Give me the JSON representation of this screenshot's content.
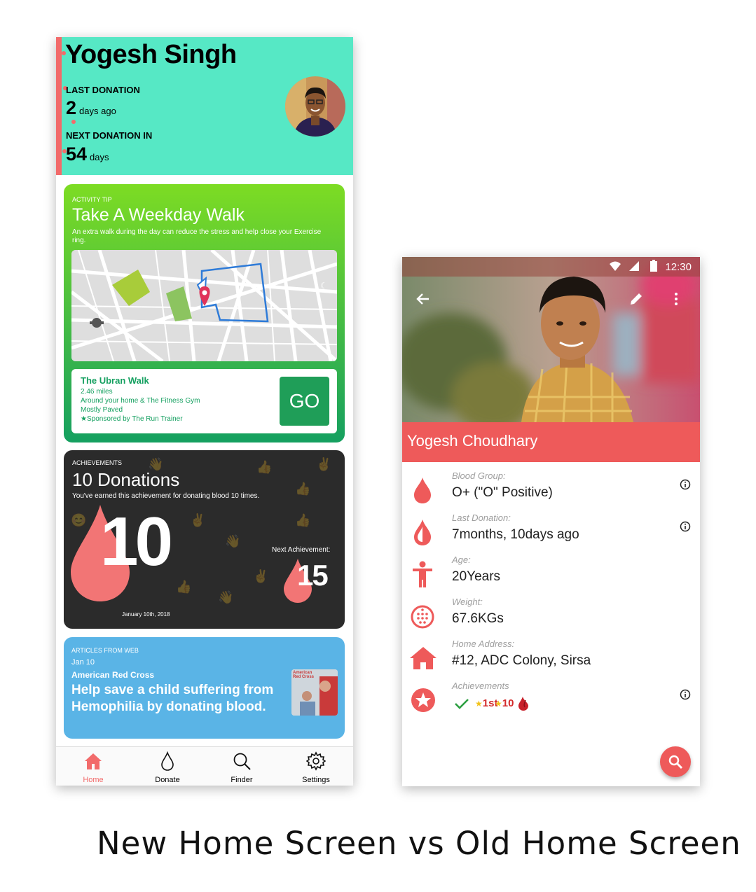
{
  "new_screen": {
    "header": {
      "name": "Yogesh Singh",
      "last_donation_label": "LAST DONATION",
      "last_donation_value": "2",
      "last_donation_unit": "days ago",
      "next_donation_label": "NEXT DONATION IN",
      "next_donation_value": "54",
      "next_donation_unit": "days"
    },
    "activity_tip": {
      "tag": "ACTIVITY TIP",
      "title": "Take A Weekday Walk",
      "description": "An extra walk during the day can reduce the stress and help close your Exercise ring.",
      "walk_title": "The Ubran Walk",
      "walk_lines": [
        "2.46 miles",
        "Around your home & The Fitness Gym",
        "Mostly Paved",
        "★Sponsored by The Run Trainer"
      ],
      "go_label": "GO"
    },
    "achievements": {
      "tag": "ACHIEVEMENTS",
      "title": "10 Donations",
      "description": "You've earned this achievement for donating blood 10 times.",
      "count": "10",
      "next_label": "Next Achievement:",
      "next_value": "15",
      "date": "January 10th, 2018"
    },
    "article": {
      "tag": "ARTICLES FROM WEB",
      "date": "Jan 10",
      "source": "American Red Cross",
      "title": "Help save a child suffering from Hemophilia by donating blood.",
      "thumb_text": "American Red Cross"
    },
    "nav": {
      "items": [
        {
          "label": "Home",
          "icon": "home-icon"
        },
        {
          "label": "Donate",
          "icon": "drop-icon"
        },
        {
          "label": "Finder",
          "icon": "search-icon"
        },
        {
          "label": "Settings",
          "icon": "gear-icon"
        }
      ]
    },
    "colors": {
      "header": "#56e8c5",
      "accent": "#f26b6b",
      "tip_top": "#7ddc23",
      "tip_bottom": "#15a060",
      "achievement_bg": "#2b2b2b",
      "article_bg": "#5ab4e6"
    }
  },
  "old_screen": {
    "status_time": "12:30",
    "name": "Yogesh Choudhary",
    "rows": [
      {
        "label": "Blood Group:",
        "value": "O+ (\"O\" Positive)",
        "icon": "blood-drop-icon"
      },
      {
        "label": "Last Donation:",
        "value": "7months, 10days ago",
        "icon": "half-drop-icon"
      },
      {
        "label": "Age:",
        "value": "20Years",
        "icon": "person-icon"
      },
      {
        "label": "Weight:",
        "value": "67.6KGs",
        "icon": "weight-icon"
      },
      {
        "label": "Home Address:",
        "value": "#12, ADC Colony, Sirsa",
        "icon": "home-icon"
      },
      {
        "label": "Achievements",
        "value": "",
        "icon": "star-badge-icon"
      }
    ],
    "achievement_badges": [
      "1st",
      "10"
    ],
    "badge_suffix": "st",
    "colors": {
      "accent": "#ee5a5a"
    }
  },
  "caption": "New Home Screen vs Old Home Screen"
}
